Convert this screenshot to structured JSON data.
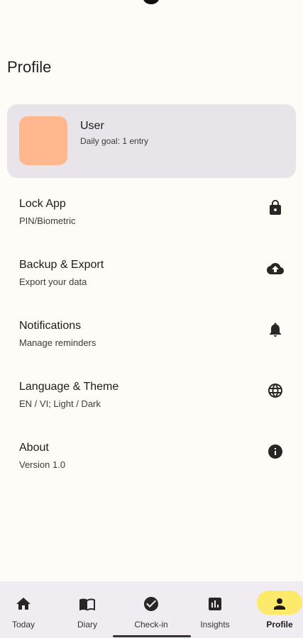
{
  "page": {
    "title": "Profile"
  },
  "user": {
    "name": "User",
    "goal": "Daily goal: 1 entry",
    "avatar_color": "#ffb78e"
  },
  "settings": [
    {
      "title": "Lock App",
      "subtitle": "PIN/Biometric",
      "icon": "lock-icon"
    },
    {
      "title": "Backup & Export",
      "subtitle": "Export your data",
      "icon": "cloud-upload-icon"
    },
    {
      "title": "Notifications",
      "subtitle": "Manage reminders",
      "icon": "bell-icon"
    },
    {
      "title": "Language & Theme",
      "subtitle": "EN / VI; Light / Dark",
      "icon": "globe-icon"
    },
    {
      "title": "About",
      "subtitle": "Version 1.0",
      "icon": "info-icon"
    }
  ],
  "nav": [
    {
      "label": "Today",
      "icon": "home-icon",
      "active": false
    },
    {
      "label": "Diary",
      "icon": "book-icon",
      "active": false
    },
    {
      "label": "Check-in",
      "icon": "check-circle-icon",
      "active": false
    },
    {
      "label": "Insights",
      "icon": "bar-chart-icon",
      "active": false
    },
    {
      "label": "Profile",
      "icon": "person-icon",
      "active": true
    }
  ],
  "colors": {
    "background": "#fffbf7",
    "card": "#e9e4ea",
    "nav_background": "#f1ecf1",
    "active_pill": "#fde96a"
  }
}
